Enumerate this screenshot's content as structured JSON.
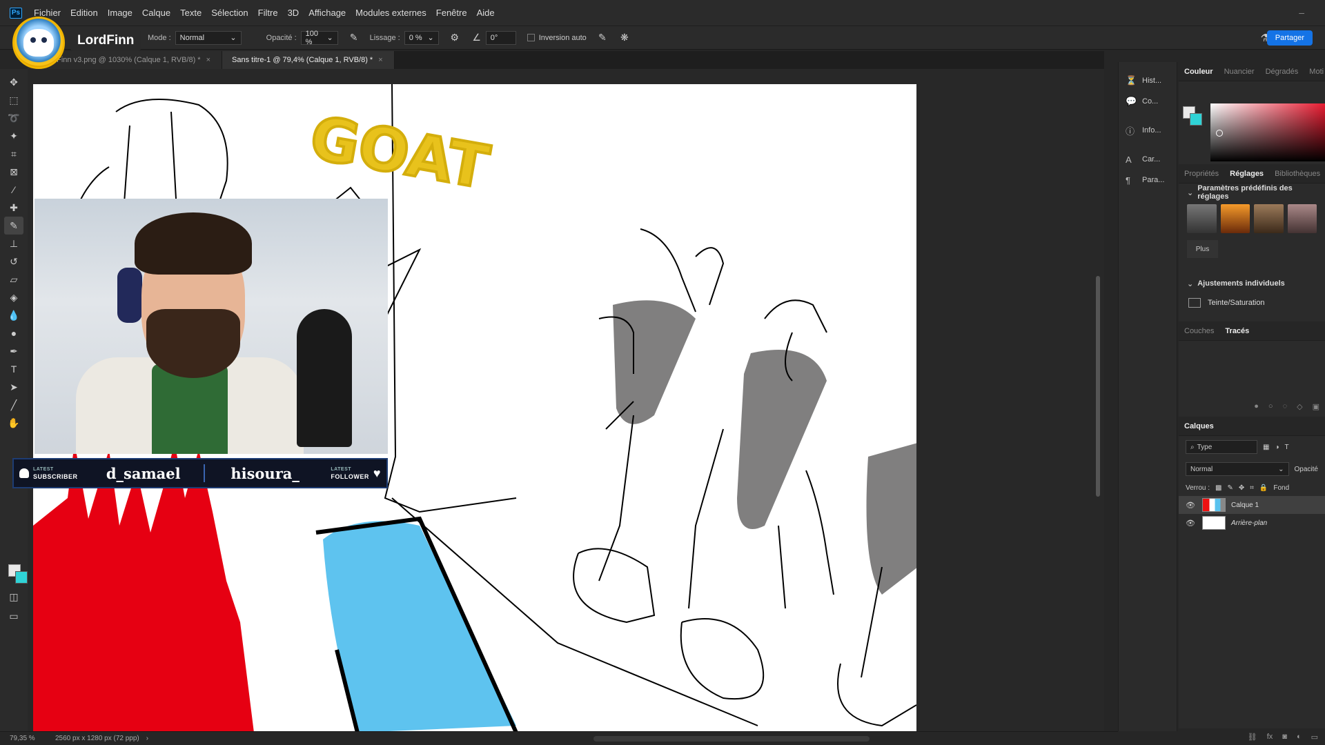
{
  "app": {
    "logo": "Ps",
    "menu": [
      "Fichier",
      "Edition",
      "Image",
      "Calque",
      "Texte",
      "Sélection",
      "Filtre",
      "3D",
      "Affichage",
      "Modules externes",
      "Fenêtre",
      "Aide"
    ]
  },
  "streamer": {
    "name": "LordFinn"
  },
  "options": {
    "mode_label": "Mode :",
    "mode_value": "Normal",
    "opacity_label": "Opacité :",
    "opacity_value": "100 %",
    "smoothing_label": "Lissage :",
    "smoothing_value": "0 %",
    "angle_value": "0°",
    "auto_invert_label": "Inversion auto",
    "share_label": "Partager"
  },
  "tabs": [
    {
      "label": "dFinn v3.png @ 1030% (Calque 1, RVB/8) *",
      "active": false
    },
    {
      "label": "Sans titre-1 @ 79,4% (Calque 1, RVB/8) *",
      "active": true
    }
  ],
  "canvas": {
    "annotation": "GOAT"
  },
  "stream_overlay": {
    "subscriber_tag_top": "LATEST",
    "subscriber_tag": "SUBSCRIBER",
    "subscriber_name": "d_samael",
    "follower_name": "hisoura_",
    "follower_tag_top": "LATEST",
    "follower_tag": "FOLLOWER"
  },
  "mini_panels": [
    "Hist...",
    "Co...",
    "Info...",
    "Car...",
    "Para..."
  ],
  "color_panel": {
    "tabs": [
      "Couleur",
      "Nuancier",
      "Dégradés",
      "Moti"
    ]
  },
  "props_panel": {
    "tabs": [
      "Propriétés",
      "Réglages",
      "Bibliothèques"
    ],
    "presets_title": "Paramètres prédéfinis des réglages",
    "more_label": "Plus",
    "individual_title": "Ajustements individuels",
    "hue_sat_label": "Teinte/Saturation"
  },
  "paths_panel": {
    "tabs": [
      "Couches",
      "Tracés"
    ]
  },
  "layers_panel": {
    "title": "Calques",
    "type_label": "Type",
    "blend_value": "Normal",
    "opacity_label": "Opacité",
    "lock_label": "Verrou :",
    "fill_label": "Fond",
    "layers": [
      "Calque 1",
      "Arrière-plan"
    ]
  },
  "status": {
    "zoom": "79,35 %",
    "dimensions": "2560 px x 1280 px (72 ppp)"
  },
  "colors": {
    "accent": "#1473e6",
    "foreground": "#eaeaea",
    "background": "#2fd3d6"
  }
}
